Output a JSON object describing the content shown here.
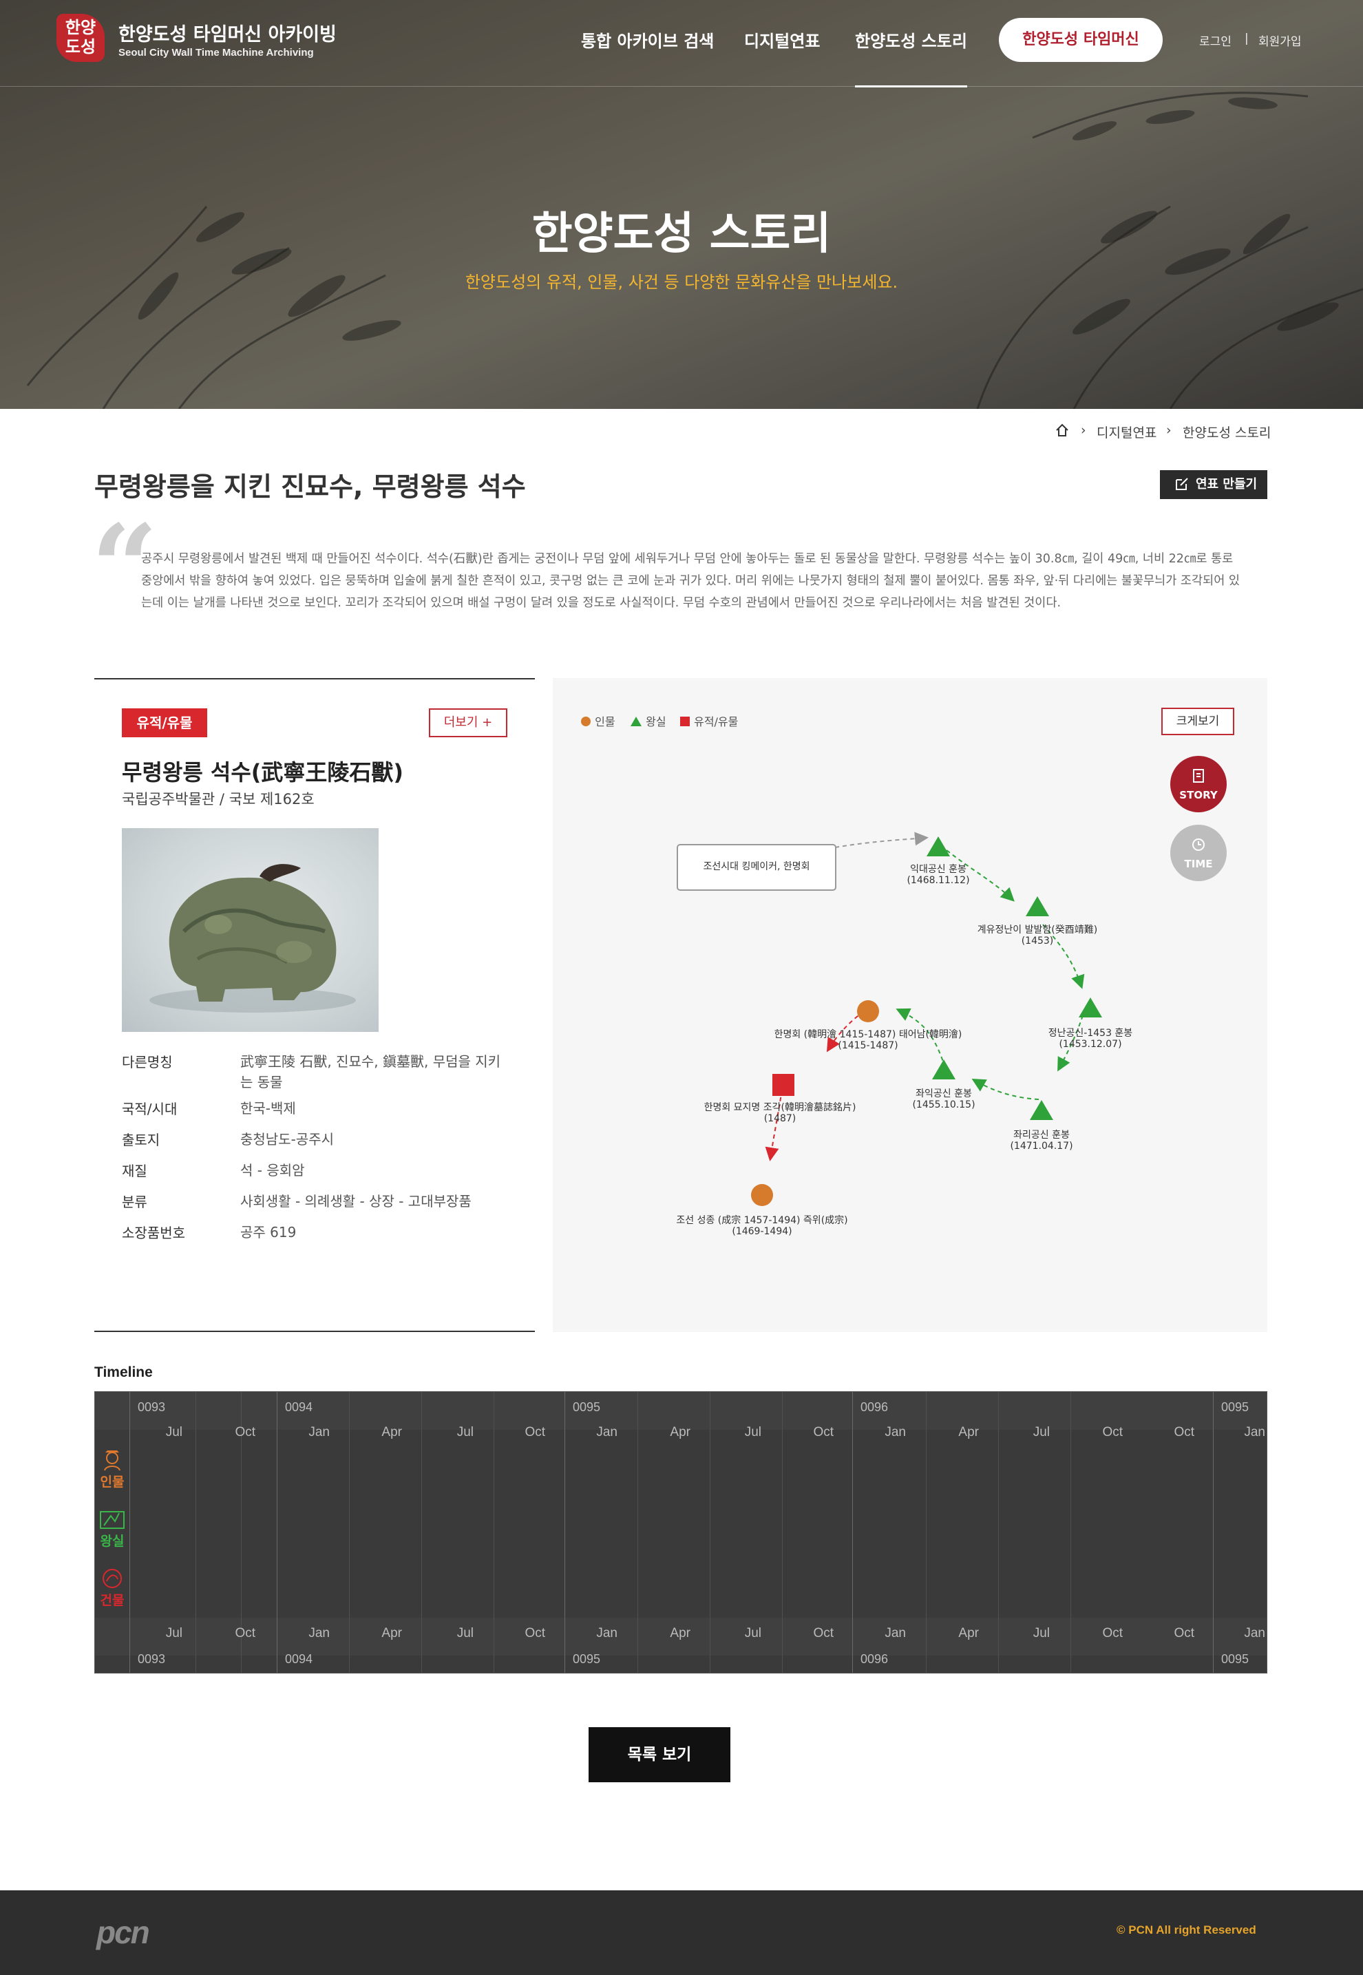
{
  "header": {
    "logo_seal": "한양\n도성",
    "logo_title": "한양도성 타임머신 아카이빙",
    "logo_subtitle": "Seoul City Wall Time Machine Archiving",
    "nav": [
      "통합 아카이브 검색",
      "디지털연표",
      "한양도성 스토리"
    ],
    "active_nav": "한양도성 스토리",
    "cta": "한양도성 타임머신",
    "login": "로그인",
    "join": "회원가입"
  },
  "hero": {
    "title": "한양도성 스토리",
    "subtitle": "한양도성의 유적, 인물, 사건 등 다양한 문화유산을 만나보세요."
  },
  "breadcrumb": [
    "디지털연표",
    "한양도성 스토리"
  ],
  "page": {
    "title": "무령왕릉을 지킨 진묘수, 무령왕릉 석수",
    "make_timeline": "연표 만들기",
    "quote_mark": "“",
    "description": "공주시 무령왕릉에서 발견된 백제 때 만들어진 석수이다. 석수(石獸)란 좁게는 궁전이나 무덤 앞에 세워두거나 무덤 안에 놓아두는 돌로 된 동물상을 말한다. 무령왕릉 석수는 높이 30.8㎝, 길이 49㎝, 너비 22㎝로 통로 중앙에서 밖을 향하여 놓여 있었다. 입은 뭉뚝하며 입술에 붉게 칠한 흔적이 있고, 콧구멍 없는 큰 코에 눈과 귀가 있다. 머리 위에는 나뭇가지 형태의 철제 뿔이 붙어있다. 몸통 좌우, 앞·뒤 다리에는 불꽃무늬가 조각되어 있는데 이는 날개를 나타낸 것으로 보인다. 꼬리가 조각되어 있으며 배설 구멍이 달려 있을 정도로 사실적이다. 무덤 수호의 관념에서 만들어진 것으로 우리나라에서는 처음 발견된 것이다."
  },
  "item": {
    "tag": "유적/유물",
    "more": "더보기 +",
    "title": "무령왕릉 석수(武寧王陵石獸)",
    "subtitle": "국립공주박물관 / 국보 제162호",
    "props": [
      {
        "k": "다른명칭",
        "v": "武寧王陵 石獸, 진묘수, 鎭墓獸, 무덤을 지키는 동물"
      },
      {
        "k": "국적/시대",
        "v": "한국-백제"
      },
      {
        "k": "출토지",
        "v": "충청남도-공주시"
      },
      {
        "k": "재질",
        "v": "석 - 응회암"
      },
      {
        "k": "분류",
        "v": "사회생활 - 의례생활 - 상장 - 고대부장품"
      },
      {
        "k": "소장품번호",
        "v": "공주 619"
      }
    ]
  },
  "graph": {
    "legend": [
      "인물",
      "왕실",
      "유적/유물"
    ],
    "legend_colors": {
      "person": "#d67a2c",
      "royal": "#2fa23a",
      "artifact": "#d9272e"
    },
    "zoom": "크게보기",
    "story": "STORY",
    "time": "TIME",
    "nodes": {
      "start": "조선시대 킹메이커, 한명회",
      "n1": "익대공신 훈봉\n(1468.11.12)",
      "n2": "계유정난이 발발함(癸酉靖難)\n(1453)",
      "n3": "정난공신-1453 훈봉\n(1453.12.07)",
      "n4": "좌리공신 훈봉\n(1471.04.17)",
      "n5": "좌익공신 훈봉\n(1455.10.15)",
      "n6": "한명회 (韓明澮 1415-1487) 태어남(韓明澮)\n(1415-1487)",
      "n7": "한명회 묘지명 조각(韓明澮墓誌銘片)\n(1487)",
      "n8": "조선 성종 (成宗 1457-1494) 즉위(成宗)\n(1469-1494)"
    }
  },
  "timeline": {
    "title": "Timeline",
    "months": [
      "Jul",
      "Oct",
      "Jan",
      "Apr",
      "Jul",
      "Oct",
      "Jan",
      "Apr",
      "Jul",
      "Oct",
      "Jan",
      "Apr",
      "Jul",
      "Oct",
      "Oct",
      "Jan"
    ],
    "years": [
      "0093",
      "0094",
      "0095",
      "0096",
      "0095"
    ],
    "categories": [
      "인물",
      "왕실",
      "건물"
    ],
    "category_colors": [
      "#e0792e",
      "#39b54a",
      "#d9272e"
    ]
  },
  "list_button": "목록 보기",
  "footer": {
    "logo": "pcn",
    "copyright": "© PCN All right Reserved"
  }
}
